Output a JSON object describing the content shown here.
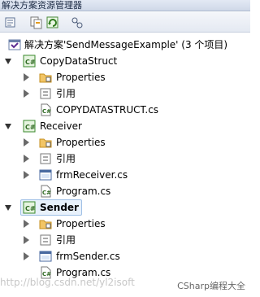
{
  "window": {
    "title": "解决方案资源管理器"
  },
  "toolbar": {
    "buttons": [
      "properties-icon",
      "show-all-files-icon",
      "refresh-icon",
      "view-class-diagram-icon"
    ]
  },
  "tree": {
    "solution": {
      "label": "解决方案'SendMessageExample' (3 个项目)"
    },
    "projects": [
      {
        "name": "CopyDataStruct",
        "bold": false,
        "items": [
          {
            "label": "Properties"
          },
          {
            "label": "引用"
          },
          {
            "label": "COPYDATASTRUCT.cs"
          }
        ]
      },
      {
        "name": "Receiver",
        "bold": false,
        "items": [
          {
            "label": "Properties"
          },
          {
            "label": "引用"
          },
          {
            "label": "frmReceiver.cs"
          },
          {
            "label": "Program.cs"
          }
        ]
      },
      {
        "name": "Sender",
        "bold": true,
        "items": [
          {
            "label": "Properties"
          },
          {
            "label": "引用"
          },
          {
            "label": "frmSender.cs"
          },
          {
            "label": "Program.cs"
          }
        ]
      }
    ]
  },
  "overlay": {
    "watermark": "http://blog.csdn.net/yl2isoft",
    "brand": "CSharp编程大全"
  }
}
